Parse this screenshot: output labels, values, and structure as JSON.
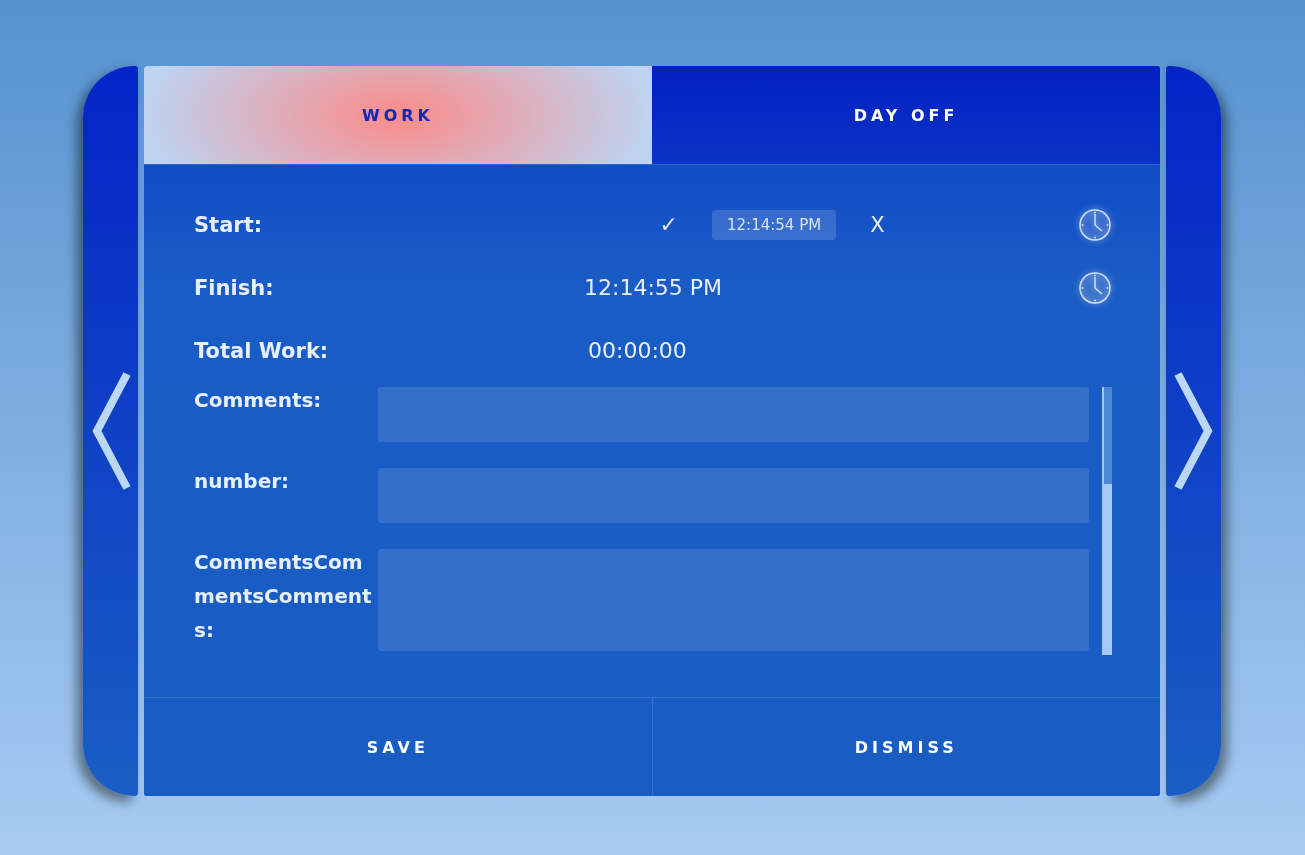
{
  "tabs": [
    {
      "label": "WORK",
      "selected": true
    },
    {
      "label": "DAY OFF",
      "selected": false
    }
  ],
  "start": {
    "label": "Start:",
    "confirm": "✓",
    "time": "12:14:54 PM",
    "cancel": "X"
  },
  "finish": {
    "label": "Finish:",
    "time": "12:14:55 PM"
  },
  "total": {
    "label": "Total Work:",
    "value": "00:00:00"
  },
  "fields": [
    {
      "label": "Comments:",
      "kind": "input"
    },
    {
      "label": "number:",
      "kind": "input"
    },
    {
      "label": "CommentsCommentsComments:",
      "kind": "textarea"
    }
  ],
  "buttons": [
    "SAVE",
    "DISMISS"
  ]
}
